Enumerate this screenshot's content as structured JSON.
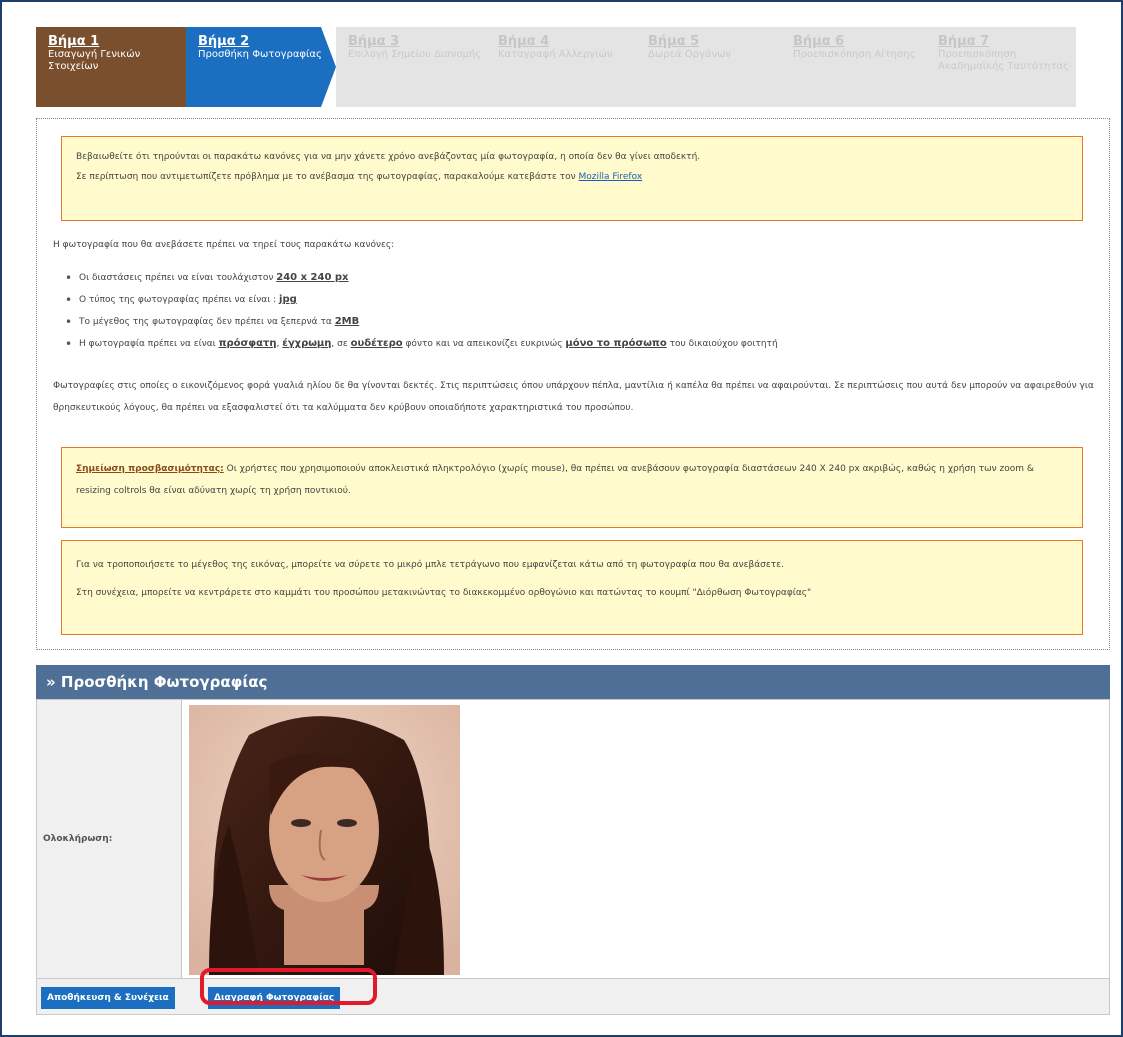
{
  "steps": [
    {
      "num": "Βήμα 1",
      "label": "Εισαγωγή Γενικών Στοιχείων"
    },
    {
      "num": "Βήμα 2",
      "label": "Προσθήκη Φωτογραφίας"
    },
    {
      "num": "Βήμα 3",
      "label": "Επιλογή Σημείου Διανομής"
    },
    {
      "num": "Βήμα 4",
      "label": "Καταγραφή Αλλεργιών"
    },
    {
      "num": "Βήμα 5",
      "label": "Δωρεά Οργάνων"
    },
    {
      "num": "Βήμα 6",
      "label": "Προεπισκόπηση Αίτησης"
    },
    {
      "num": "Βήμα 7",
      "label": "Προεπισκόπηση Ακαδημαϊκής Ταυτότητας"
    }
  ],
  "info_box": {
    "line1": "Βεβαιωθείτε ότι τηρούνται οι παρακάτω κανόνες για να μην χάνετε χρόνο ανεβάζοντας μία φωτογραφία, η οποία δεν θα γίνει αποδεκτή.",
    "line2": "Σε περίπτωση που αντιμετωπίζετε πρόβλημα με το ανέβασμα της φωτογραφίας, παρακαλούμε κατεβάστε τον",
    "link": "Mozilla Firefox"
  },
  "rules_intro": "Η φωτογραφία που θα ανεβάσετε πρέπει να τηρεί τους παρακάτω κανόνες:",
  "rules": {
    "r1_text": "Οι διαστάσεις πρέπει να είναι τουλάχιστον",
    "r1_value": "240 x 240 px",
    "r2_text": "Ο τύπος της φωτογραφίας πρέπει να είναι :",
    "r2_value": "jpg",
    "r3_text": "Το μέγεθος της φωτογραφίας δεν πρέπει να ξεπερνά τα",
    "r3_value": "2MB",
    "r4_a": "Η φωτογραφία πρέπει να είναι",
    "r4_b": "πρόσφατη",
    "r4_c": ",",
    "r4_d": "έγχρωμη",
    "r4_e": ", σε",
    "r4_f": "ουδέτερο",
    "r4_g": "φόντο και να απεικονίζει ευκρινώς",
    "r4_h": "μόνο το πρόσωπο",
    "r4_i": "του δικαιούχου φοιτητή"
  },
  "glasses_text": "Φωτογραφίες στις οποίες ο εικονιζόμενος φορά γυαλιά ηλίου δε θα γίνονται δεκτές. Στις περιπτώσεις όπου υπάρχουν πέπλα, μαντίλια ή καπέλα θα πρέπει να αφαιρούνται. Σε περιπτώσεις που αυτά δεν μπορούν να αφαιρεθούν για θρησκευτικούς λόγους, θα πρέπει να εξασφαλιστεί ότι τα καλύμματα δεν κρύβουν οποιαδήποτε χαρακτηριστικά του προσώπου.",
  "accessibility": {
    "title": "Σημείωση προσβασιμότητας:",
    "text": "Οι χρήστες που χρησιμοποιούν αποκλειστικά πληκτρολόγιο (χωρίς mouse), θα πρέπει να ανεβάσουν φωτογραφία διαστάσεων 240 X 240 px ακριβώς, καθώς η χρήση των zoom & resizing coltrols θα είναι αδύνατη χωρίς τη χρήση ποντικιού."
  },
  "resize_box": {
    "line1": "Για να τροποποιήσετε το μέγεθος της εικόνας, μπορείτε να σύρετε το μικρό μπλε τετράγωνο που εμφανίζεται κάτω από τη φωτογραφία που θα ανεβάσετε.",
    "line2": "Στη συνέχεια, μπορείτε να κεντράρετε στο καμμάτι του προσώπου μετακινώντας το διακεκομμένο ορθογώνιο και πατώντας το κουμπί \"Διόρθωση Φωτογραφίας\""
  },
  "photo_section": {
    "title": "» Προσθήκη Φωτογραφίας",
    "label": "Ολοκλήρωση:"
  },
  "buttons": {
    "save": "Αποθήκευση & Συνέχεια",
    "delete": "Διαγραφή Φωτογραφίας"
  },
  "colors": {
    "step_done": "#7a4f2e",
    "step_active": "#1c6fc0",
    "header": "#4e6f96",
    "note_bg": "#fffbcc",
    "note_border": "#e7782a",
    "highlight_ring": "#e0192b"
  }
}
